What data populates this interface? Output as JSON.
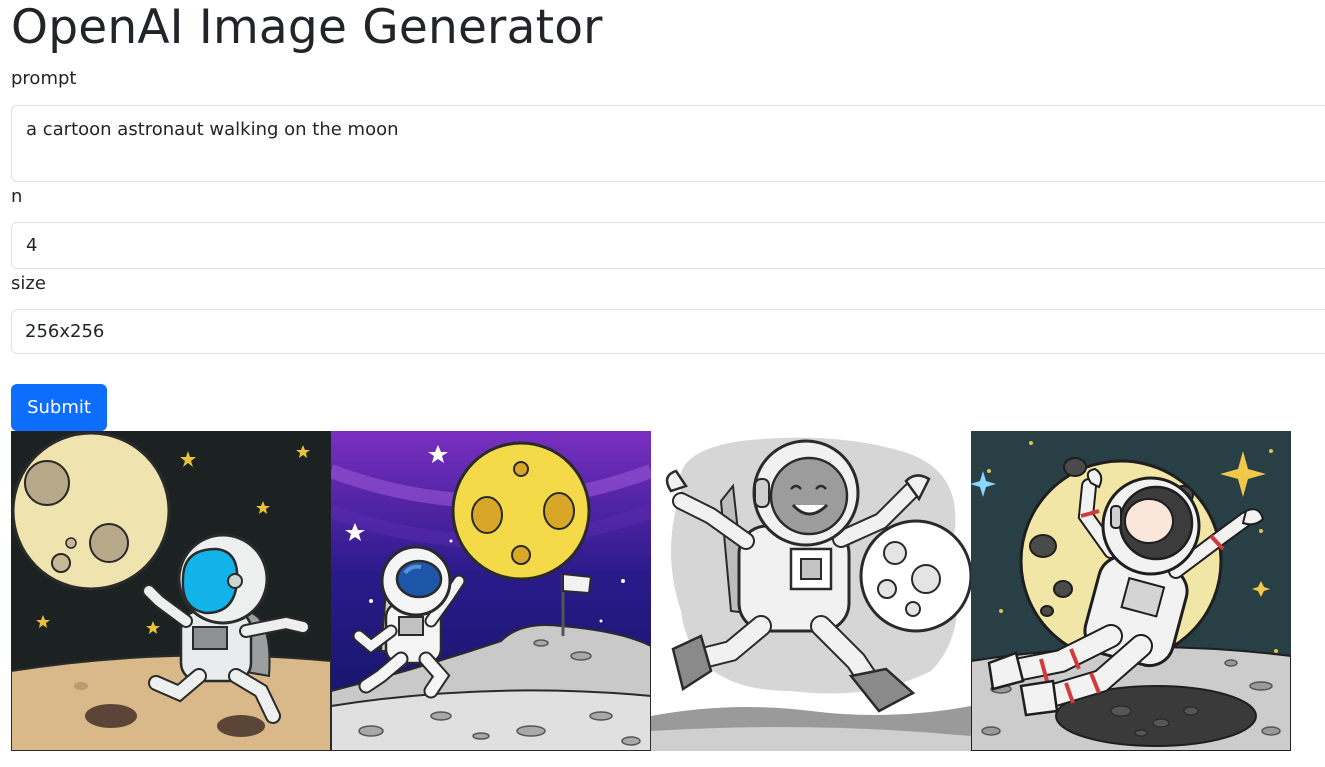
{
  "header": {
    "title": "OpenAI Image Generator"
  },
  "form": {
    "prompt": {
      "label": "prompt",
      "value": "a cartoon astronaut walking on the moon"
    },
    "n": {
      "label": "n",
      "value": "4"
    },
    "size": {
      "label": "size",
      "value": "256x256"
    },
    "submit_label": "Submit"
  },
  "gallery": {
    "images": [
      {
        "icon": "astronaut-walking-beige-moon-image"
      },
      {
        "icon": "astronaut-jumping-yellow-moon-flag-image"
      },
      {
        "icon": "astronaut-running-sketch-image"
      },
      {
        "icon": "astronaut-floating-red-stripes-image"
      }
    ]
  },
  "colors": {
    "accent": "#0d6efd",
    "text": "#212529",
    "border": "#dee2e6"
  }
}
